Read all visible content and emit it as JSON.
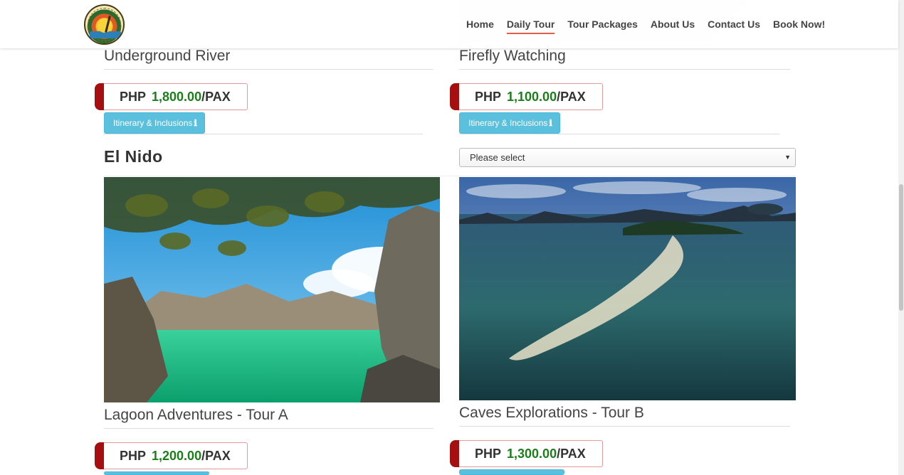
{
  "nav": {
    "logo": "del-mundo-travel-logo",
    "items": [
      "Home",
      "Daily Tour",
      "Tour Packages",
      "About Us",
      "Contact Us",
      "Book Now!"
    ],
    "active": "Daily Tour"
  },
  "tours_top": [
    {
      "title": "Underground River",
      "currency": "PHP",
      "amount": "1,800.00",
      "unit": "/PAX",
      "button": "Itinerary & Inclusions",
      "button_icon": "info-icon"
    },
    {
      "title": "Firefly Watching",
      "currency": "PHP",
      "amount": "1,100.00",
      "unit": "/PAX",
      "button": "Itinerary & Inclusions",
      "button_icon": "info-icon"
    }
  ],
  "section": {
    "heading": "El Nido",
    "select_value": "Please select"
  },
  "tours_bottom": [
    {
      "title": "Lagoon Adventures - Tour A",
      "currency": "PHP",
      "amount": "1,200.00",
      "unit": "/PAX"
    },
    {
      "title": "Caves Explorations - Tour B",
      "currency": "PHP",
      "amount": "1,300.00",
      "unit": "/PAX"
    }
  ],
  "colors": {
    "price_amount": "#1a7f1a",
    "price_tab": "#a50f0f",
    "info_button": "#5bc0de",
    "nav_active_underline": "#e25d4a"
  }
}
